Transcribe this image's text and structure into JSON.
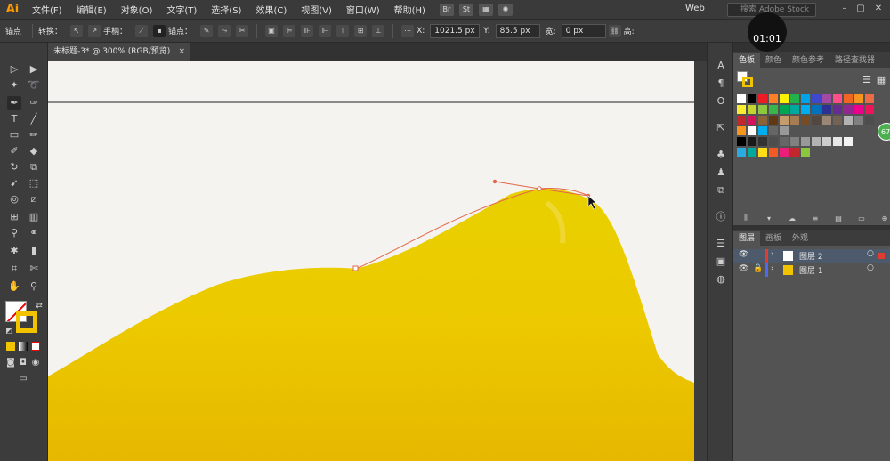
{
  "app": {
    "logo": "Ai"
  },
  "menu": [
    "文件(F)",
    "编辑(E)",
    "对象(O)",
    "文字(T)",
    "选择(S)",
    "效果(C)",
    "视图(V)",
    "窗口(W)",
    "帮助(H)"
  ],
  "menubar_icons": [
    "Br",
    "St"
  ],
  "workspace": "Web",
  "search": {
    "placeholder": "搜索 Adobe Stock"
  },
  "timer": "01:01",
  "control": {
    "mode_label": "锚点",
    "convert_label": "转换：",
    "handles_label": "手柄：",
    "anchor_label": "锚点：",
    "x_label": "X:",
    "x_value": "1021.5 px",
    "y_label": "Y:",
    "y_value": "85.5 px",
    "w_label": "宽:",
    "w_value": "0 px",
    "h_label": "高:"
  },
  "document_tab": {
    "title": "未标题-3* @ 300% (RGB/预览)",
    "close": "×"
  },
  "toolbox": {
    "tools": [
      "selection-icon",
      "direct-selection-icon",
      "magic-wand-icon",
      "lasso-icon",
      "pen-icon",
      "curvature-icon",
      "type-icon",
      "line-icon",
      "rectangle-icon",
      "paintbrush-icon",
      "shaper-icon",
      "eraser-icon",
      "rotate-icon",
      "scale-icon",
      "warp-icon",
      "free-transform-icon",
      "shape-builder-icon",
      "perspective-icon",
      "mesh-icon",
      "gradient-icon",
      "eyedropper-icon",
      "blend-icon",
      "symbol-sprayer-icon",
      "column-graph-icon",
      "artboard-icon",
      "slice-icon",
      "hand-icon",
      "zoom-icon"
    ]
  },
  "swatches_panel": {
    "tabs": [
      "色板",
      "颜色",
      "颜色参考",
      "路径查找器"
    ],
    "colors_row1": [
      "#ffffff",
      "#000000",
      "#ed1c24",
      "#ff7f27",
      "#fff200",
      "#22b14c",
      "#00a2e8",
      "#3f48cc",
      "#a349a4",
      "#ff4f8b",
      "#f26522",
      "#f7941d",
      "#ed6c46"
    ],
    "colors_row2": [
      "#f9ed32",
      "#c4d62e",
      "#8dc63f",
      "#39b54a",
      "#00a651",
      "#00a99d",
      "#00aeef",
      "#0072bc",
      "#2e3192",
      "#662d91",
      "#92278f",
      "#ec008c",
      "#ed145b"
    ],
    "colors_row3": [
      "#c1272d",
      "#d4145a",
      "#8c6239",
      "#603813",
      "#c69c6d",
      "#a67c52",
      "#754c24",
      "#534741",
      "#998675",
      "#736357",
      "#b3b3b3",
      "#808080",
      "#4d4d4d"
    ],
    "colors_row4": [
      "#f7941d",
      "#ffffff",
      "#00aeef",
      "#666666",
      "#999999"
    ],
    "colors_row5": [
      "#000000",
      "#1a1a1a",
      "#333333",
      "#4d4d4d",
      "#666666",
      "#808080",
      "#999999",
      "#b3b3b3",
      "#cccccc",
      "#e6e6e6",
      "#f2f2f2"
    ],
    "colors_row6": [
      "#29abe2",
      "#00a99d",
      "#ffde17",
      "#f15a24",
      "#ed1e79",
      "#c1272d",
      "#8cc63f"
    ]
  },
  "layers_panel": {
    "tabs": [
      "图层",
      "画板",
      "外观"
    ],
    "layers": [
      {
        "name": "图层 2",
        "color": "#e03c31"
      },
      {
        "name": "图层 1",
        "color": "#4f6bed"
      }
    ]
  },
  "side_badge": "67"
}
